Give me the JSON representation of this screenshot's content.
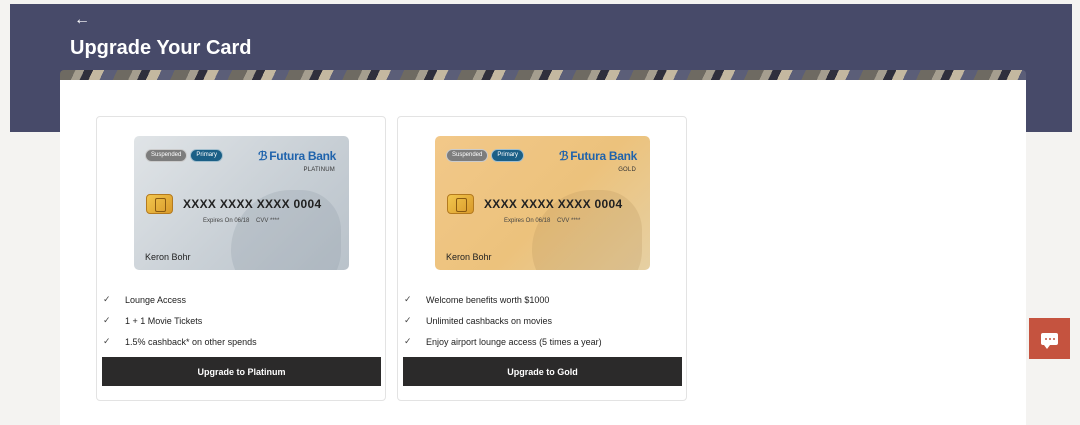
{
  "header": {
    "back_icon": "←",
    "title": "Upgrade Your Card",
    "background_color": "#474a69"
  },
  "cards": [
    {
      "badges": {
        "suspended": "Suspended",
        "primary": "Primary"
      },
      "bank_name": "Futura Bank",
      "tier": "PLATINUM",
      "card_number": "XXXX XXXX XXXX 0004",
      "expiry": "Expires On 06/18",
      "cvv": "CVV ****",
      "holder": "Keron Bohr",
      "benefits": [
        "Lounge Access",
        "1 + 1 Movie Tickets",
        "1.5% cashback* on other spends"
      ],
      "button_label": "Upgrade to Platinum"
    },
    {
      "badges": {
        "suspended": "Suspended",
        "primary": "Primary"
      },
      "bank_name": "Futura Bank",
      "tier": "GOLD",
      "card_number": "XXXX XXXX XXXX 0004",
      "expiry": "Expires On 06/18",
      "cvv": "CVV ****",
      "holder": "Keron Bohr",
      "benefits": [
        "Welcome benefits worth $1000",
        "Unlimited cashbacks on movies",
        "Enjoy airport lounge access (5 times a year)"
      ],
      "button_label": "Upgrade to Gold"
    }
  ],
  "check_icon": "✓",
  "chat": {
    "icon": "chat-icon",
    "color": "#c5533f"
  }
}
